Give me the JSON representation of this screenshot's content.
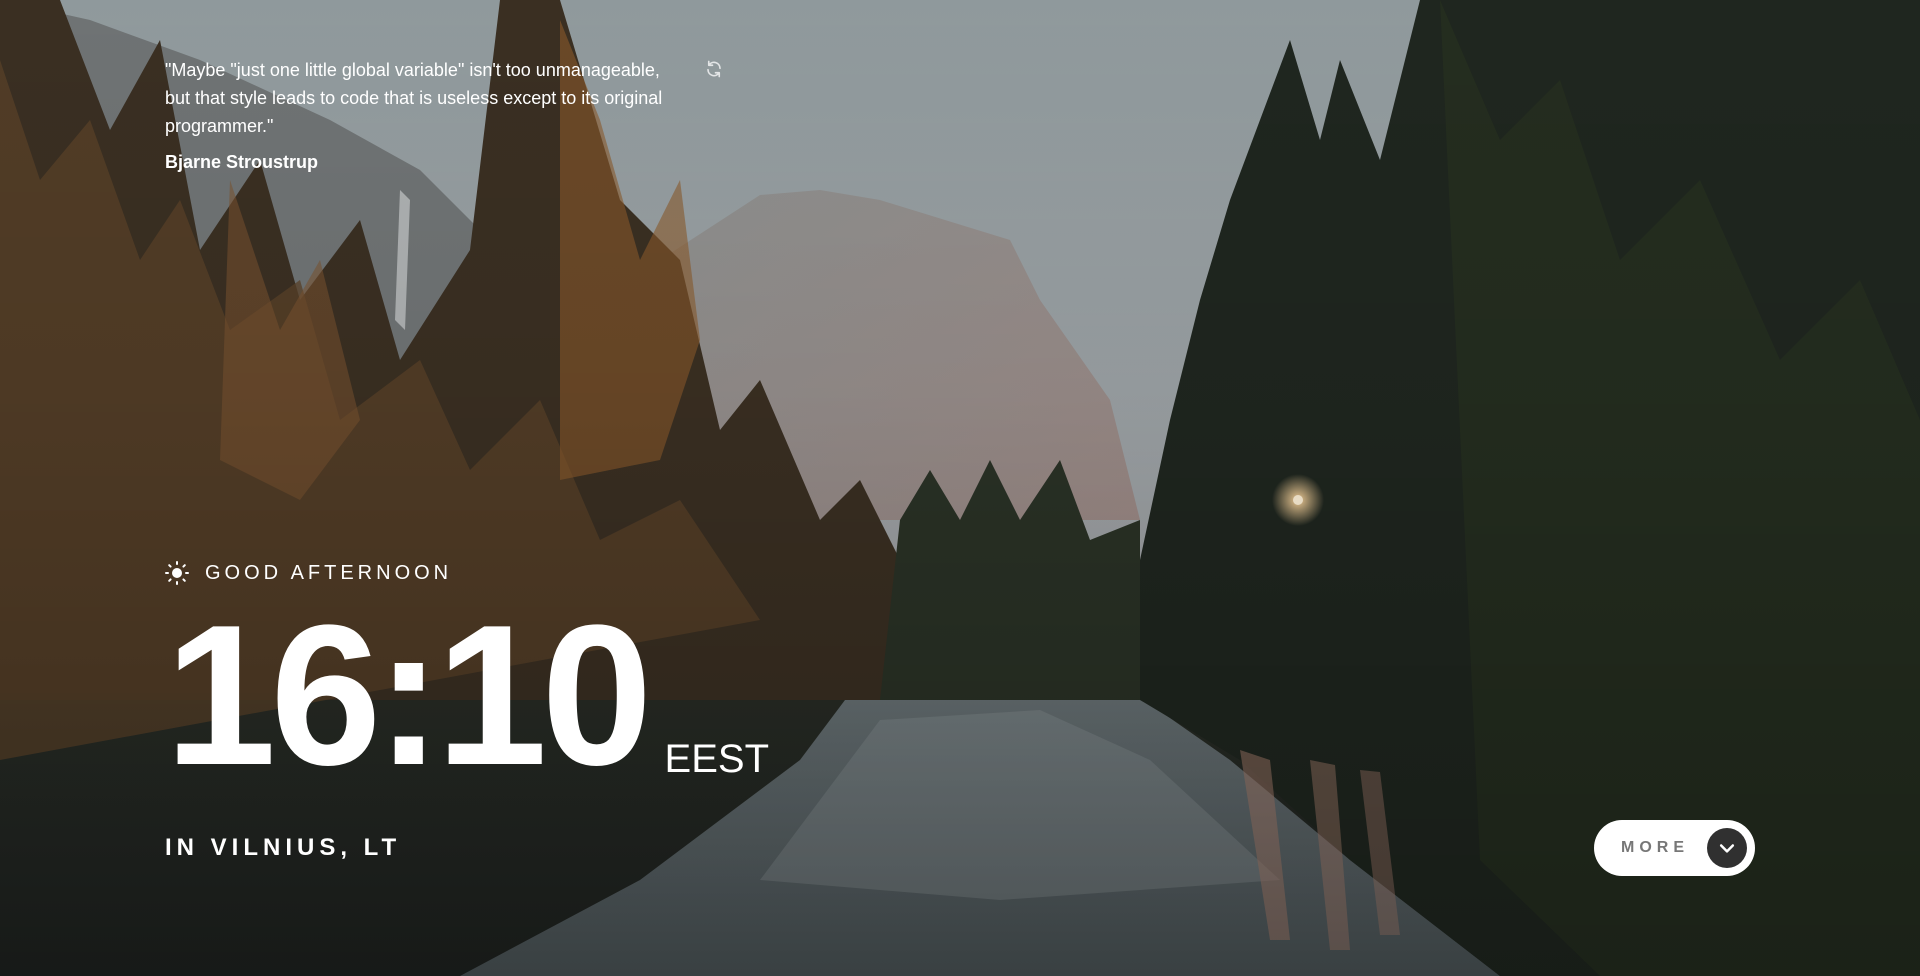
{
  "quote": {
    "text": "\"Maybe \"just one little global variable\" isn't too unmanageable, but that style leads to code that is useless except to its original programmer.\"",
    "author": "Bjarne Stroustrup"
  },
  "greeting": {
    "text": "GOOD AFTERNOON",
    "icon": "sun-icon"
  },
  "clock": {
    "time": "16:10",
    "timezone": "EEST"
  },
  "location": {
    "text": "IN VILNIUS, LT"
  },
  "more_button": {
    "label": "MORE",
    "icon": "chevron-down-icon"
  },
  "colors": {
    "text": "#ffffff",
    "button_bg": "#ffffff",
    "button_text": "#777777",
    "button_icon_bg": "#303030"
  }
}
